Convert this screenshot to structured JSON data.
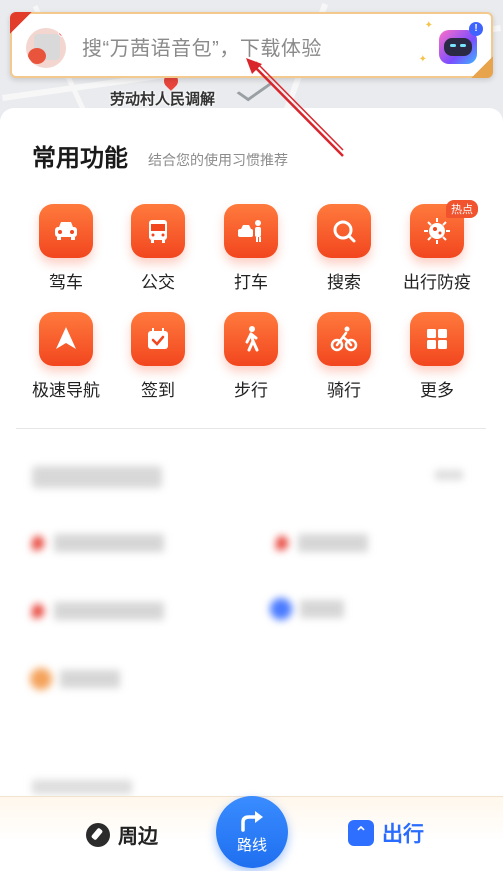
{
  "map": {
    "place_label": "劳动村人民调解"
  },
  "search": {
    "placeholder": "搜“万茜语音包”，下载体验"
  },
  "common_functions": {
    "title": "常用功能",
    "subtitle": "结合您的使用习惯推荐",
    "items": [
      {
        "label": "驾车",
        "icon": "car-icon"
      },
      {
        "label": "公交",
        "icon": "bus-icon"
      },
      {
        "label": "打车",
        "icon": "taxi-icon"
      },
      {
        "label": "搜索",
        "icon": "search-icon"
      },
      {
        "label": "出行防疫",
        "icon": "virus-icon",
        "badge": "热点"
      },
      {
        "label": "极速导航",
        "icon": "navigation-arrow-icon"
      },
      {
        "label": "签到",
        "icon": "calendar-check-icon"
      },
      {
        "label": "步行",
        "icon": "walking-icon"
      },
      {
        "label": "骑行",
        "icon": "bicycle-icon"
      },
      {
        "label": "更多",
        "icon": "grid-icon"
      }
    ]
  },
  "bottom_nav": {
    "nearby": "周边",
    "route": "路线",
    "trip": "出行"
  },
  "colors": {
    "accent_orange": "#f2461f",
    "route_blue": "#1f6ff0",
    "trip_blue": "#2a6cff"
  }
}
